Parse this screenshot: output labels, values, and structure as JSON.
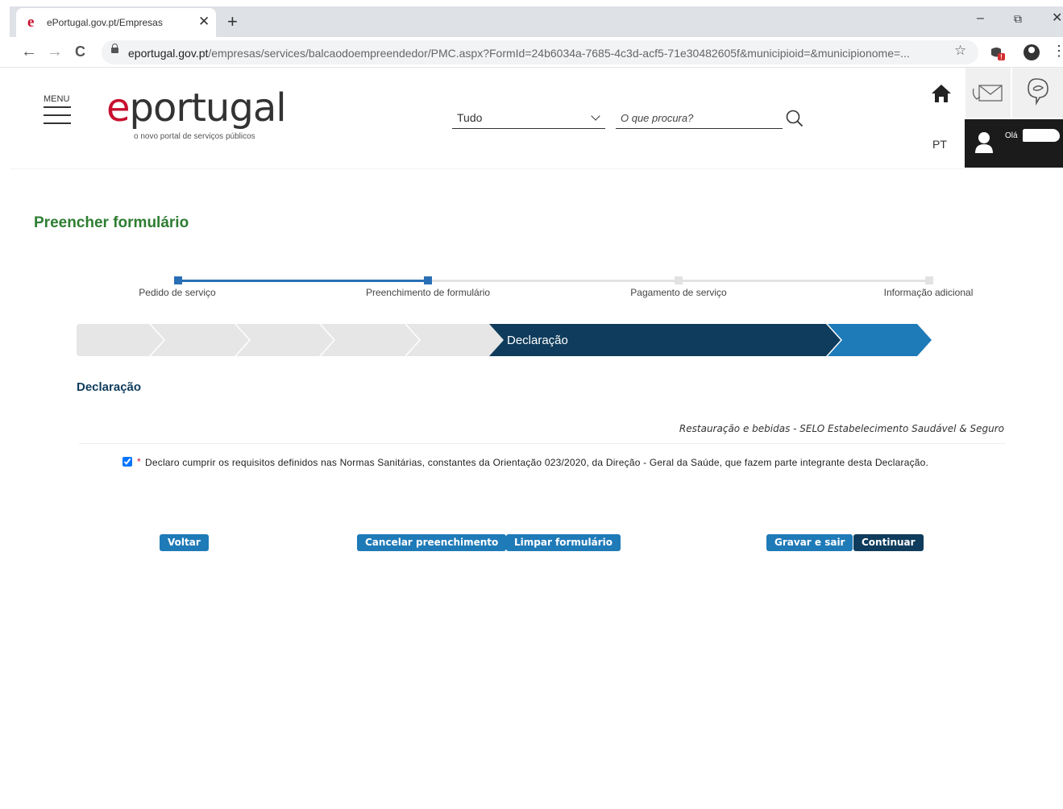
{
  "browser": {
    "tab_title": "ePortugal.gov.pt/Empresas",
    "tab_favicon": "e",
    "close_tab": "✕",
    "new_tab": "+",
    "minimize": "–",
    "restore": "⧉",
    "close_window": "✕",
    "back": "←",
    "forward": "→",
    "reload": "C",
    "url_host": "eportugal.gov.pt",
    "url_path": "/empresas/services/balcaodoempreendedor/PMC.aspx?FormId=24b6034a-7685-4c3d-acf5-71e30482605f&municipioid=&municipionome=...",
    "bookmark": "☆",
    "menu": "⋮"
  },
  "header": {
    "menu_label": "MENU",
    "logo_e": "e",
    "logo_text": "portugal",
    "logo_tagline": "o novo portal de serviços públicos",
    "scope_value": "Tudo",
    "search_placeholder": "O que procura?",
    "language": "PT",
    "greeting": "Olá"
  },
  "page": {
    "title": "Preencher formulário"
  },
  "progress": {
    "steps": [
      "Pedido de serviço",
      "Preenchimento de formulário",
      "Pagamento de serviço",
      "Informação adicional"
    ],
    "current_step": 2
  },
  "wizard": {
    "active_label": "Declaração"
  },
  "form": {
    "section_title": "Declaração",
    "service_name": "Restauração e bebidas - SELO Estabelecimento Saudável & Seguro",
    "required_mark": "*",
    "declaration_text": "Declaro cumprir os requisitos definidos nas Normas Sanitárias, constantes da Orientação 023/2020, da Direção - Geral da Saúde, que fazem parte integrante desta Declaração.",
    "declaration_checked": true
  },
  "buttons": {
    "back": "Voltar",
    "cancel": "Cancelar preenchimento",
    "clear": "Limpar formulário",
    "save_exit": "Gravar e sair",
    "continue": "Continuar"
  },
  "colors": {
    "title_green": "#2e7d32",
    "brand_red": "#c8102e",
    "dark_blue": "#0f3c5c",
    "accent_blue": "#1f7ab8",
    "step_done": "#2a6fb5"
  }
}
